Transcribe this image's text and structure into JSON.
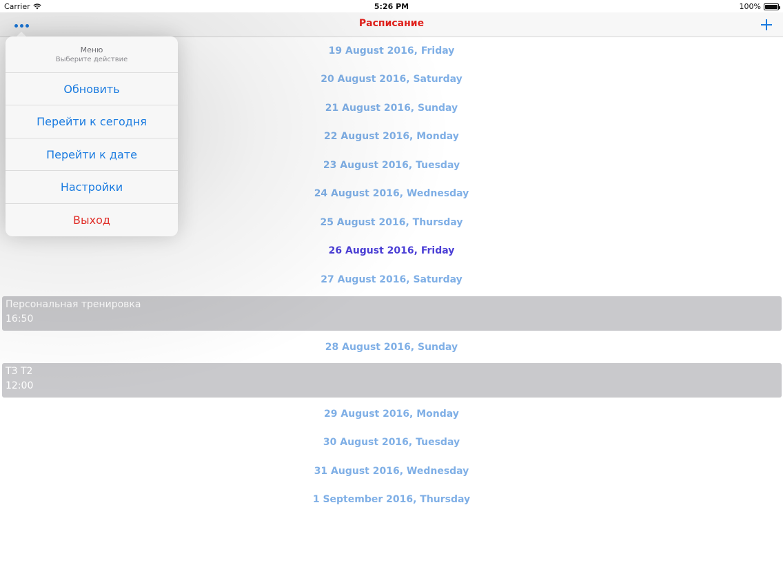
{
  "status_bar": {
    "carrier": "Carrier",
    "time": "5:26 PM",
    "battery": "100%"
  },
  "nav": {
    "title": "Расписание",
    "title_color": "#e0201b"
  },
  "menu": {
    "title": "Меню",
    "subtitle": "Выберите действие",
    "items": [
      {
        "label": "Обновить"
      },
      {
        "label": "Перейти к сегодня"
      },
      {
        "label": "Перейти к дате"
      },
      {
        "label": "Настройки"
      },
      {
        "label": "Выход"
      }
    ]
  },
  "schedule": {
    "dates": [
      "19 August 2016, Friday",
      "20 August 2016, Saturday",
      "21 August 2016, Sunday",
      "22 August 2016, Monday",
      "23 August 2016, Tuesday",
      "24 August 2016, Wednesday",
      "25 August 2016, Thursday",
      "26 August 2016, Friday",
      "27 August 2016, Saturday",
      "28 August 2016, Sunday",
      "29 August 2016, Monday",
      "30 August 2016, Tuesday",
      "31 August 2016, Wednesday",
      "1 September 2016, Thursday"
    ],
    "events": [
      {
        "title": "Персональная тренировка",
        "time": "16:50"
      },
      {
        "title": "ТЗ Т2",
        "time": "12:00"
      }
    ]
  },
  "colors": {
    "accent": "#1a7be0",
    "date_text": "#7fafe6",
    "today_text": "#4b3fd6",
    "destructive": "#e0302a",
    "event_bg": "#c9c9cc"
  }
}
